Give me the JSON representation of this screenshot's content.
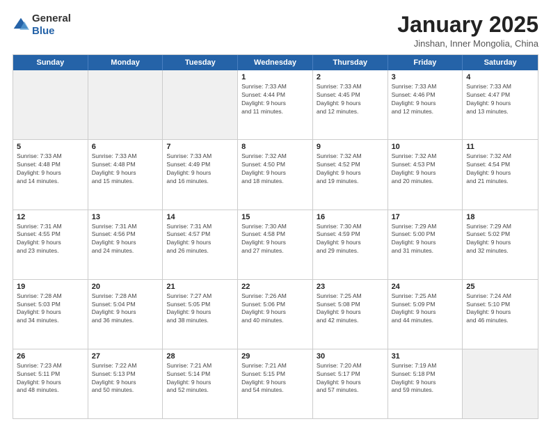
{
  "header": {
    "logo_general": "General",
    "logo_blue": "Blue",
    "title": "January 2025",
    "location": "Jinshan, Inner Mongolia, China"
  },
  "days_of_week": [
    "Sunday",
    "Monday",
    "Tuesday",
    "Wednesday",
    "Thursday",
    "Friday",
    "Saturday"
  ],
  "weeks": [
    [
      {
        "day": "",
        "info": "",
        "empty": true
      },
      {
        "day": "",
        "info": "",
        "empty": true
      },
      {
        "day": "",
        "info": "",
        "empty": true
      },
      {
        "day": "1",
        "info": "Sunrise: 7:33 AM\nSunset: 4:44 PM\nDaylight: 9 hours\nand 11 minutes."
      },
      {
        "day": "2",
        "info": "Sunrise: 7:33 AM\nSunset: 4:45 PM\nDaylight: 9 hours\nand 12 minutes."
      },
      {
        "day": "3",
        "info": "Sunrise: 7:33 AM\nSunset: 4:46 PM\nDaylight: 9 hours\nand 12 minutes."
      },
      {
        "day": "4",
        "info": "Sunrise: 7:33 AM\nSunset: 4:47 PM\nDaylight: 9 hours\nand 13 minutes."
      }
    ],
    [
      {
        "day": "5",
        "info": "Sunrise: 7:33 AM\nSunset: 4:48 PM\nDaylight: 9 hours\nand 14 minutes."
      },
      {
        "day": "6",
        "info": "Sunrise: 7:33 AM\nSunset: 4:48 PM\nDaylight: 9 hours\nand 15 minutes."
      },
      {
        "day": "7",
        "info": "Sunrise: 7:33 AM\nSunset: 4:49 PM\nDaylight: 9 hours\nand 16 minutes."
      },
      {
        "day": "8",
        "info": "Sunrise: 7:32 AM\nSunset: 4:50 PM\nDaylight: 9 hours\nand 18 minutes."
      },
      {
        "day": "9",
        "info": "Sunrise: 7:32 AM\nSunset: 4:52 PM\nDaylight: 9 hours\nand 19 minutes."
      },
      {
        "day": "10",
        "info": "Sunrise: 7:32 AM\nSunset: 4:53 PM\nDaylight: 9 hours\nand 20 minutes."
      },
      {
        "day": "11",
        "info": "Sunrise: 7:32 AM\nSunset: 4:54 PM\nDaylight: 9 hours\nand 21 minutes."
      }
    ],
    [
      {
        "day": "12",
        "info": "Sunrise: 7:31 AM\nSunset: 4:55 PM\nDaylight: 9 hours\nand 23 minutes."
      },
      {
        "day": "13",
        "info": "Sunrise: 7:31 AM\nSunset: 4:56 PM\nDaylight: 9 hours\nand 24 minutes."
      },
      {
        "day": "14",
        "info": "Sunrise: 7:31 AM\nSunset: 4:57 PM\nDaylight: 9 hours\nand 26 minutes."
      },
      {
        "day": "15",
        "info": "Sunrise: 7:30 AM\nSunset: 4:58 PM\nDaylight: 9 hours\nand 27 minutes."
      },
      {
        "day": "16",
        "info": "Sunrise: 7:30 AM\nSunset: 4:59 PM\nDaylight: 9 hours\nand 29 minutes."
      },
      {
        "day": "17",
        "info": "Sunrise: 7:29 AM\nSunset: 5:00 PM\nDaylight: 9 hours\nand 31 minutes."
      },
      {
        "day": "18",
        "info": "Sunrise: 7:29 AM\nSunset: 5:02 PM\nDaylight: 9 hours\nand 32 minutes."
      }
    ],
    [
      {
        "day": "19",
        "info": "Sunrise: 7:28 AM\nSunset: 5:03 PM\nDaylight: 9 hours\nand 34 minutes."
      },
      {
        "day": "20",
        "info": "Sunrise: 7:28 AM\nSunset: 5:04 PM\nDaylight: 9 hours\nand 36 minutes."
      },
      {
        "day": "21",
        "info": "Sunrise: 7:27 AM\nSunset: 5:05 PM\nDaylight: 9 hours\nand 38 minutes."
      },
      {
        "day": "22",
        "info": "Sunrise: 7:26 AM\nSunset: 5:06 PM\nDaylight: 9 hours\nand 40 minutes."
      },
      {
        "day": "23",
        "info": "Sunrise: 7:25 AM\nSunset: 5:08 PM\nDaylight: 9 hours\nand 42 minutes."
      },
      {
        "day": "24",
        "info": "Sunrise: 7:25 AM\nSunset: 5:09 PM\nDaylight: 9 hours\nand 44 minutes."
      },
      {
        "day": "25",
        "info": "Sunrise: 7:24 AM\nSunset: 5:10 PM\nDaylight: 9 hours\nand 46 minutes."
      }
    ],
    [
      {
        "day": "26",
        "info": "Sunrise: 7:23 AM\nSunset: 5:11 PM\nDaylight: 9 hours\nand 48 minutes."
      },
      {
        "day": "27",
        "info": "Sunrise: 7:22 AM\nSunset: 5:13 PM\nDaylight: 9 hours\nand 50 minutes."
      },
      {
        "day": "28",
        "info": "Sunrise: 7:21 AM\nSunset: 5:14 PM\nDaylight: 9 hours\nand 52 minutes."
      },
      {
        "day": "29",
        "info": "Sunrise: 7:21 AM\nSunset: 5:15 PM\nDaylight: 9 hours\nand 54 minutes."
      },
      {
        "day": "30",
        "info": "Sunrise: 7:20 AM\nSunset: 5:17 PM\nDaylight: 9 hours\nand 57 minutes."
      },
      {
        "day": "31",
        "info": "Sunrise: 7:19 AM\nSunset: 5:18 PM\nDaylight: 9 hours\nand 59 minutes."
      },
      {
        "day": "",
        "info": "",
        "empty": true
      }
    ]
  ]
}
